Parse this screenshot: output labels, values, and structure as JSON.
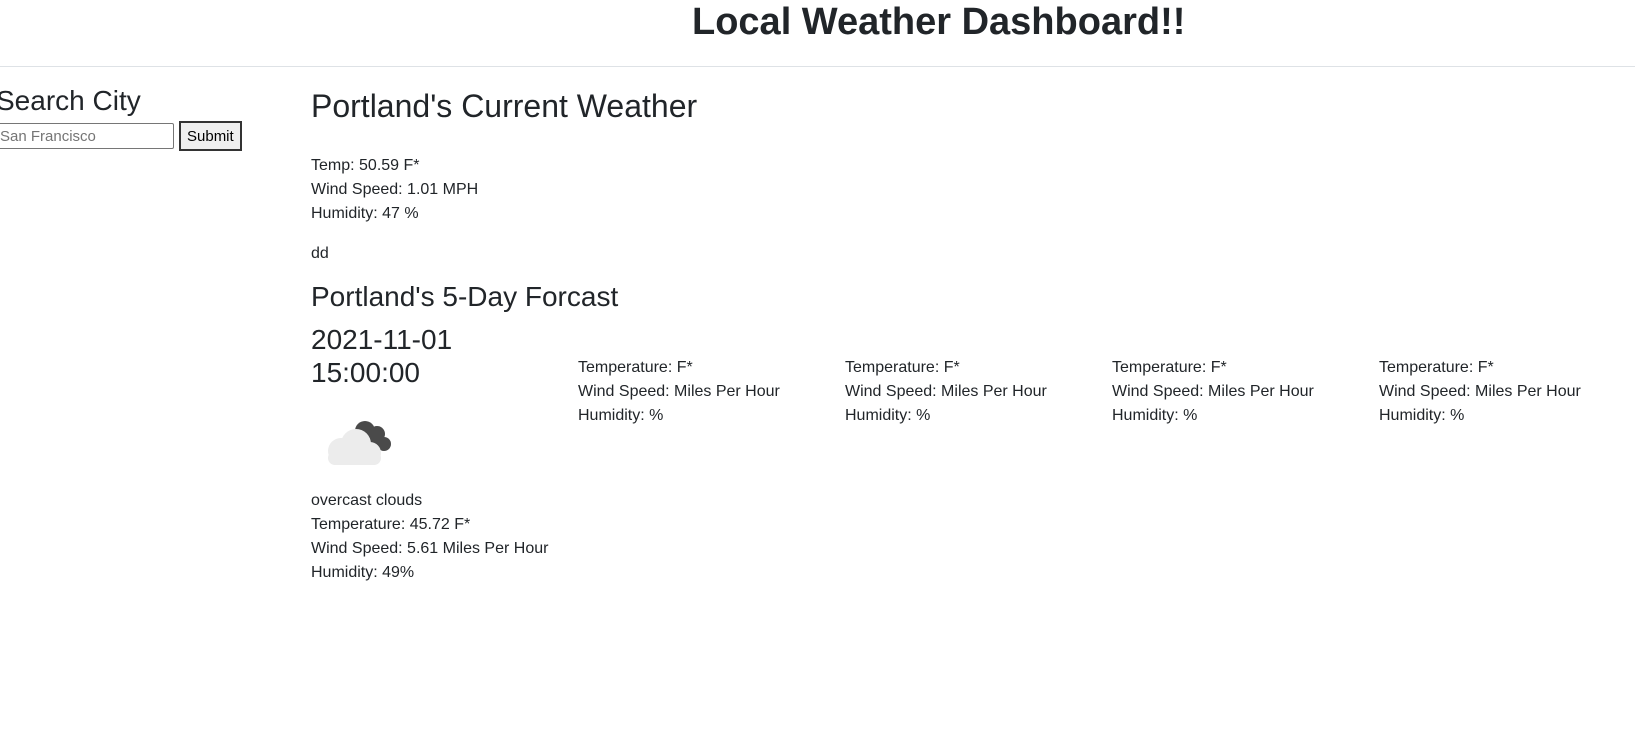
{
  "header": {
    "title": "Local Weather Dashboard!!"
  },
  "sidebar": {
    "heading": "Search City",
    "search_placeholder": "San Francisco",
    "submit_label": "Submit"
  },
  "current": {
    "title": "Portland's Current Weather",
    "temp": "Temp: 50.59 F*",
    "wind": "Wind Speed: 1.01 MPH",
    "humidity": "Humidity: 47 %",
    "extra": "dd"
  },
  "forecast": {
    "title": "Portland's 5-Day Forcast",
    "days": [
      {
        "date_line1": "2021-11-01",
        "date_line2": "15:00:00",
        "icon": "cloud-icon",
        "description": "overcast clouds",
        "temperature": "Temperature: 45.72 F*",
        "wind": "Wind Speed: 5.61 Miles Per Hour",
        "humidity": "Humidity: 49%"
      },
      {
        "temperature": "Temperature: F*",
        "wind": "Wind Speed: Miles Per Hour",
        "humidity": "Humidity: %"
      },
      {
        "temperature": "Temperature: F*",
        "wind": "Wind Speed: Miles Per Hour",
        "humidity": "Humidity: %"
      },
      {
        "temperature": "Temperature: F*",
        "wind": "Wind Speed: Miles Per Hour",
        "humidity": "Humidity: %"
      },
      {
        "temperature": "Temperature: F*",
        "wind": "Wind Speed: Miles Per Hour",
        "humidity": "Humidity: %"
      }
    ]
  }
}
